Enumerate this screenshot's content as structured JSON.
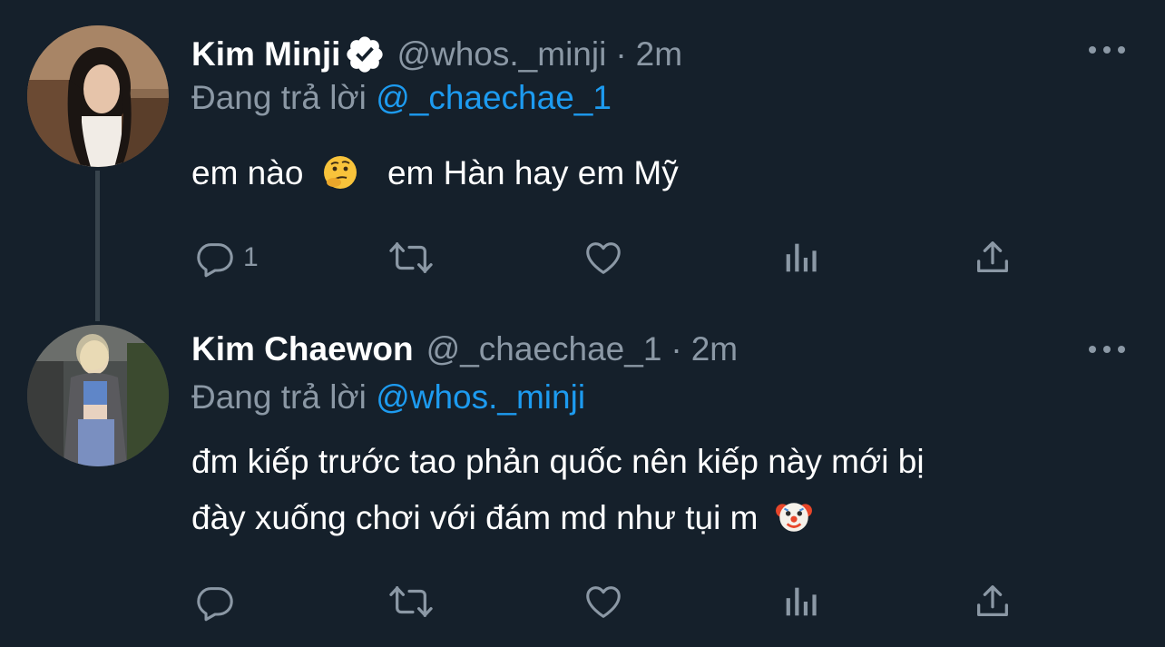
{
  "tweets": [
    {
      "name": "Kim Minji",
      "verified": true,
      "handle": "@whos._minji",
      "separator": "·",
      "time": "2m",
      "replying_prefix": "Đang trả lời",
      "replying_to": "@_chaechae_1",
      "text_part1": "em nào",
      "emoji1": "thinking-face-emoji",
      "text_part2": "em Hàn hay em Mỹ",
      "reply_count": "1",
      "icons": [
        "reply-icon",
        "retweet-icon",
        "like-icon",
        "analytics-icon",
        "share-icon"
      ]
    },
    {
      "name": "Kim Chaewon",
      "verified": false,
      "handle": "@_chaechae_1",
      "separator": "·",
      "time": "2m",
      "replying_prefix": "Đang trả lời",
      "replying_to": "@whos._minji",
      "text_line1": "đm kiếp trước tao phản quốc nên kiếp này mới bị",
      "text_line2": "đày xuống chơi với đám md như tụi m",
      "emoji2": "clown-face-emoji",
      "reply_count": "",
      "icons": [
        "reply-icon",
        "retweet-icon",
        "like-icon",
        "analytics-icon",
        "share-icon"
      ]
    }
  ],
  "colors": {
    "background": "#15202b",
    "secondary_text": "#8b98a5",
    "link": "#1d9bf0",
    "verified_badge": "#ffffff"
  }
}
